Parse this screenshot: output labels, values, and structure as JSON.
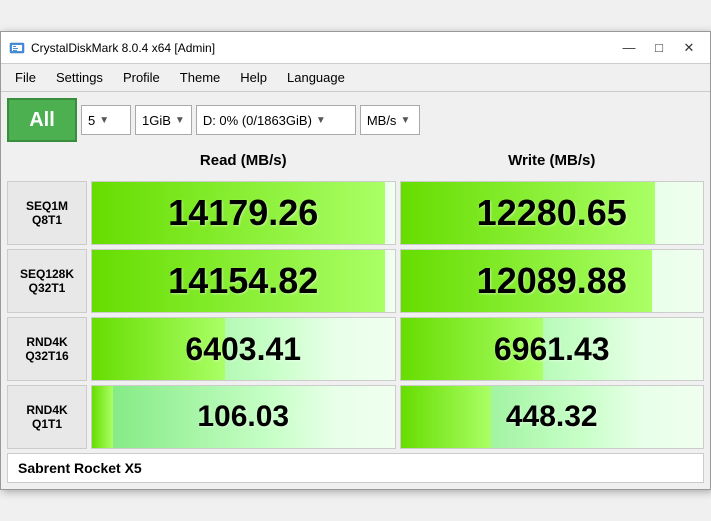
{
  "window": {
    "title": "CrystalDiskMark 8.0.4 x64 [Admin]",
    "icon": "disk-icon"
  },
  "titlebar": {
    "minimize_label": "—",
    "maximize_label": "□",
    "close_label": "✕"
  },
  "menu": {
    "items": [
      "File",
      "Settings",
      "Profile",
      "Theme",
      "Help",
      "Language"
    ]
  },
  "toolbar": {
    "all_label": "All",
    "runs_value": "5",
    "size_value": "1GiB",
    "drive_value": "D: 0% (0/1863GiB)",
    "unit_value": "MB/s"
  },
  "table": {
    "col_read": "Read (MB/s)",
    "col_write": "Write (MB/s)",
    "rows": [
      {
        "label_line1": "SEQ1M",
        "label_line2": "Q8T1",
        "read": "14179.26",
        "write": "12280.65",
        "read_pct": 97,
        "write_pct": 84
      },
      {
        "label_line1": "SEQ128K",
        "label_line2": "Q32T1",
        "read": "14154.82",
        "write": "12089.88",
        "read_pct": 97,
        "write_pct": 83
      },
      {
        "label_line1": "RND4K",
        "label_line2": "Q32T16",
        "read": "6403.41",
        "write": "6961.43",
        "read_pct": 44,
        "write_pct": 47
      },
      {
        "label_line1": "RND4K",
        "label_line2": "Q1T1",
        "read": "106.03",
        "write": "448.32",
        "read_pct": 7,
        "write_pct": 30
      }
    ]
  },
  "footer": {
    "drive_name": "Sabrent Rocket X5"
  }
}
